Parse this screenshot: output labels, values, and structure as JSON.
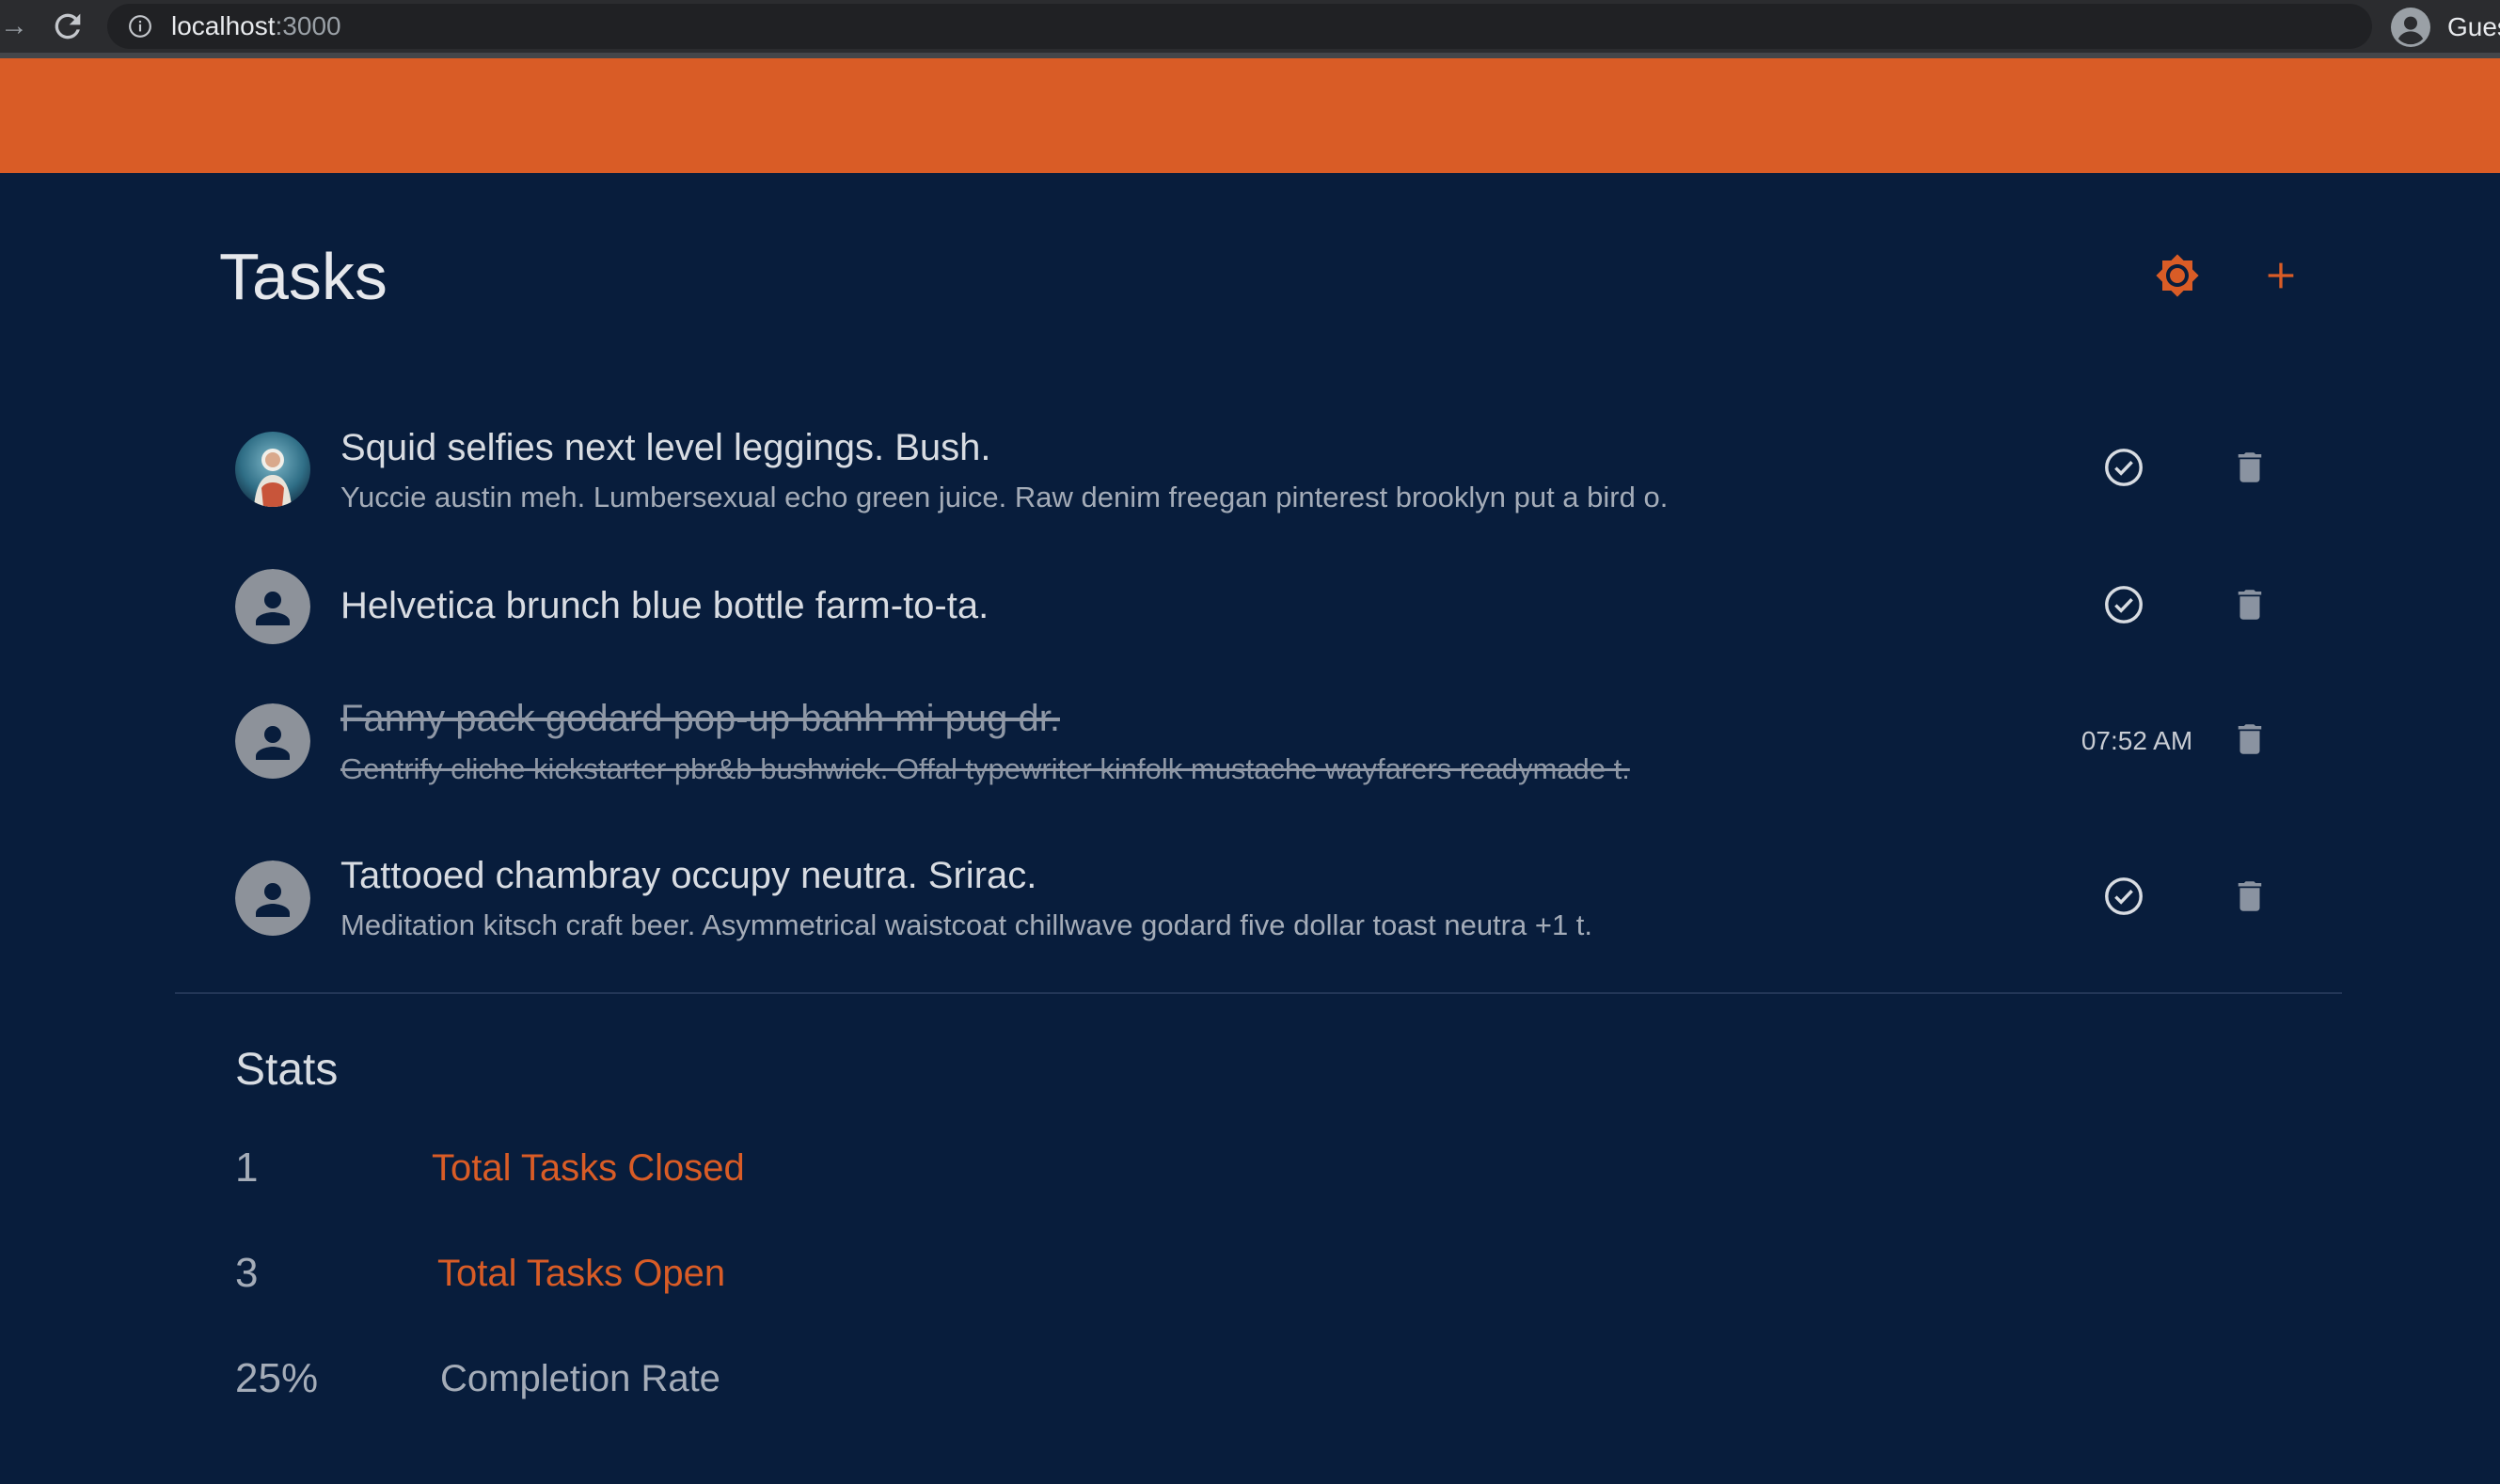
{
  "browser": {
    "url_host": "localhost",
    "url_port": ":3000",
    "profile_label": "Guest"
  },
  "colors": {
    "accent": "#d95c26",
    "background": "#081d3c"
  },
  "page": {
    "title": "Tasks",
    "actions": {
      "settings_icon": "settings-gear-icon",
      "add_icon": "plus-icon"
    }
  },
  "tasks": [
    {
      "title": "Squid selfies next level leggings. Bush.",
      "description": "Yuccie austin meh. Lumbersexual echo green juice. Raw denim freegan pinterest brooklyn put a bird o.",
      "avatar": "photo",
      "completed": false
    },
    {
      "title": "Helvetica brunch blue bottle farm-to-ta.",
      "description": "",
      "avatar": "person-icon",
      "completed": false
    },
    {
      "title": "Fanny pack godard pop-up banh mi pug dr.",
      "description": "Gentrify cliche kickstarter pbr&b bushwick. Offal typewriter kinfolk mustache wayfarers readymade t.",
      "avatar": "person-icon",
      "completed": true,
      "closed_time": "07:52 AM"
    },
    {
      "title": "Tattooed chambray occupy neutra. Srirac.",
      "description": "Meditation kitsch craft beer. Asymmetrical waistcoat chillwave godard five dollar toast neutra +1 t.",
      "avatar": "person-icon",
      "completed": false
    }
  ],
  "stats": {
    "heading": "Stats",
    "items": [
      {
        "value": "1",
        "label": "Total Tasks Closed"
      },
      {
        "value": "3",
        "label": "Total Tasks Open"
      },
      {
        "value": "25%",
        "label": "Completion Rate"
      }
    ]
  }
}
